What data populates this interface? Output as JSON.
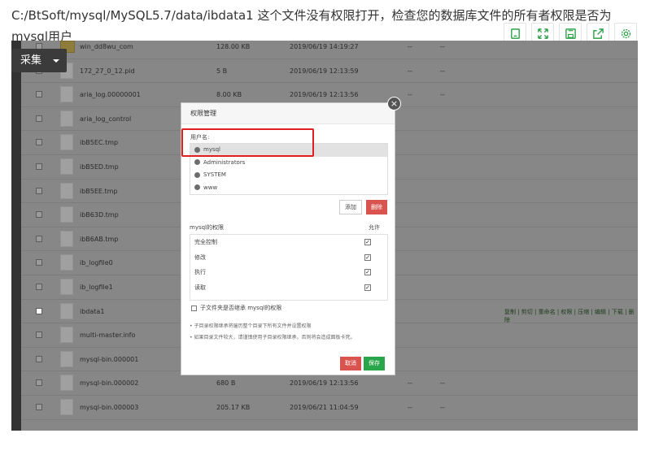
{
  "question": {
    "text": "C:/BtSoft/mysql/MySQL5.7/data/ibdata1   这个文件没有权限打开，检查您的数据库文件的所有者权限是否为mysql用户"
  },
  "toolbar": {
    "icons": [
      "copy-icon",
      "fullscreen-icon",
      "save-icon",
      "share-icon",
      "settings-icon"
    ]
  },
  "collect_button": {
    "label": "采集"
  },
  "files": [
    {
      "name": "win_dd8wu_com",
      "size": "128.00 KB",
      "time": "2019/06/19 14:19:27",
      "d1": "--",
      "d2": "--",
      "folder": true,
      "checked": false,
      "ops": ""
    },
    {
      "name": "172_27_0_12.pid",
      "size": "5 B",
      "time": "2019/06/19 12:13:59",
      "d1": "--",
      "d2": "--",
      "folder": false,
      "checked": false,
      "ops": ""
    },
    {
      "name": "aria_log.00000001",
      "size": "8.00 KB",
      "time": "2019/06/19 12:13:56",
      "d1": "--",
      "d2": "--",
      "folder": false,
      "checked": false,
      "ops": ""
    },
    {
      "name": "aria_log_control",
      "size": "",
      "time": "",
      "d1": "",
      "d2": "",
      "folder": false,
      "checked": false,
      "ops": ""
    },
    {
      "name": "ibB5EC.tmp",
      "size": "",
      "time": "",
      "d1": "",
      "d2": "",
      "folder": false,
      "checked": false,
      "ops": ""
    },
    {
      "name": "ibB5ED.tmp",
      "size": "",
      "time": "",
      "d1": "",
      "d2": "",
      "folder": false,
      "checked": false,
      "ops": ""
    },
    {
      "name": "ibB5EE.tmp",
      "size": "",
      "time": "",
      "d1": "",
      "d2": "",
      "folder": false,
      "checked": false,
      "ops": ""
    },
    {
      "name": "ibB63D.tmp",
      "size": "",
      "time": "",
      "d1": "",
      "d2": "",
      "folder": false,
      "checked": false,
      "ops": ""
    },
    {
      "name": "ibB6AB.tmp",
      "size": "",
      "time": "",
      "d1": "",
      "d2": "",
      "folder": false,
      "checked": false,
      "ops": ""
    },
    {
      "name": "ib_logfile0",
      "size": "",
      "time": "",
      "d1": "",
      "d2": "",
      "folder": false,
      "checked": false,
      "ops": ""
    },
    {
      "name": "ib_logfile1",
      "size": "",
      "time": "",
      "d1": "",
      "d2": "",
      "folder": false,
      "checked": false,
      "ops": ""
    },
    {
      "name": "ibdata1",
      "size": "",
      "time": "",
      "d1": "",
      "d2": "",
      "folder": false,
      "checked": true,
      "ops": "复制 | 剪切 | 重命名 | 权限 | 压缩 | 编辑 | 下载 | 删除"
    },
    {
      "name": "multi-master.info",
      "size": "",
      "time": "",
      "d1": "",
      "d2": "",
      "folder": false,
      "checked": false,
      "ops": ""
    },
    {
      "name": "mysql-bin.000001",
      "size": "",
      "time": "",
      "d1": "",
      "d2": "",
      "folder": false,
      "checked": false,
      "ops": ""
    },
    {
      "name": "mysql-bin.000002",
      "size": "680 B",
      "time": "2019/06/19 12:13:56",
      "d1": "--",
      "d2": "--",
      "folder": false,
      "checked": false,
      "ops": ""
    },
    {
      "name": "mysql-bin.000003",
      "size": "205.17 KB",
      "time": "2019/06/21 11:04:59",
      "d1": "--",
      "d2": "--",
      "folder": false,
      "checked": false,
      "ops": ""
    }
  ],
  "dialog": {
    "title": "权限管理",
    "users_label": "用户名:",
    "users": [
      "mysql",
      "Administrators",
      "SYSTEM",
      "www"
    ],
    "add_label": "添加",
    "delete_label": "删除",
    "perm_header": "mysql的权限",
    "allow_header": "允许",
    "permissions": [
      {
        "label": "完全控制",
        "allowed": true
      },
      {
        "label": "修改",
        "allowed": true
      },
      {
        "label": "执行",
        "allowed": true
      },
      {
        "label": "读取",
        "allowed": true
      }
    ],
    "inherit_label": "子文件夹是否继承 mysql的权限",
    "notes": [
      "子目录权限继承将遍历整个目录下所有文件并设置权限",
      "如果目录文件较大，请谨慎使用子目录权限继承，否则将会造成面板卡死。"
    ],
    "cancel_label": "取消",
    "save_label": "保存"
  }
}
